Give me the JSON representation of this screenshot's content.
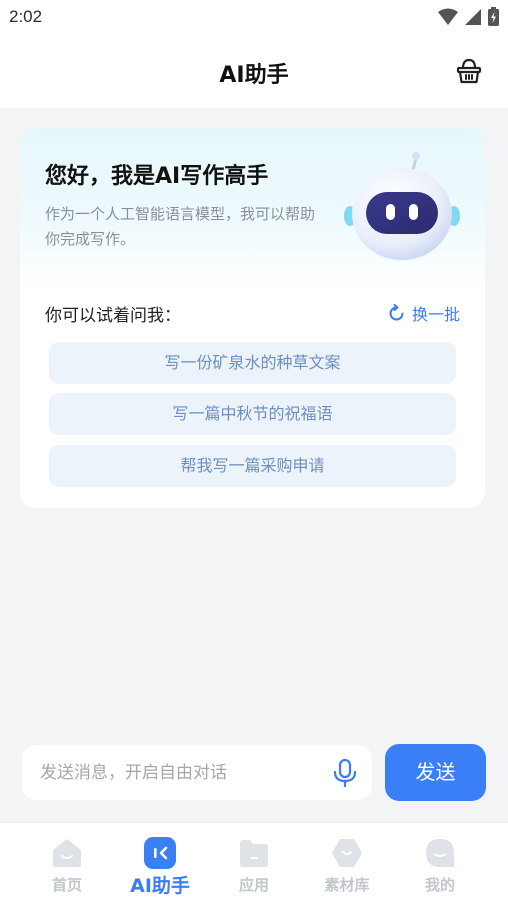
{
  "status_bar": {
    "time": "2:02"
  },
  "header": {
    "title": "AI助手",
    "basket_icon": "basket-icon"
  },
  "greeting": {
    "title": "您好，我是AI写作高手",
    "description": "作为一个人工智能语言模型，我可以帮助你完成写作。"
  },
  "suggestions": {
    "label": "你可以试着问我：",
    "refresh_label": "换一批",
    "items": [
      "写一份矿泉水的种草文案",
      "写一篇中秋节的祝福语",
      "帮我写一篇采购申请"
    ]
  },
  "composer": {
    "placeholder": "发送消息，开启自由对话",
    "value": "",
    "send_label": "发送"
  },
  "tabbar": {
    "tabs": [
      {
        "label": "首页",
        "icon": "home-icon",
        "active": false
      },
      {
        "label": "AI助手",
        "icon": "ai-assistant-icon",
        "active": true
      },
      {
        "label": "应用",
        "icon": "apps-icon",
        "active": false
      },
      {
        "label": "素材库",
        "icon": "materials-icon",
        "active": false
      },
      {
        "label": "我的",
        "icon": "profile-icon",
        "active": false
      }
    ]
  },
  "colors": {
    "accent": "#3b7ff6",
    "suggestion_bg": "#edf3fb",
    "suggestion_text": "#6b8fbf",
    "inactive_tab": "#c3c7cd"
  }
}
